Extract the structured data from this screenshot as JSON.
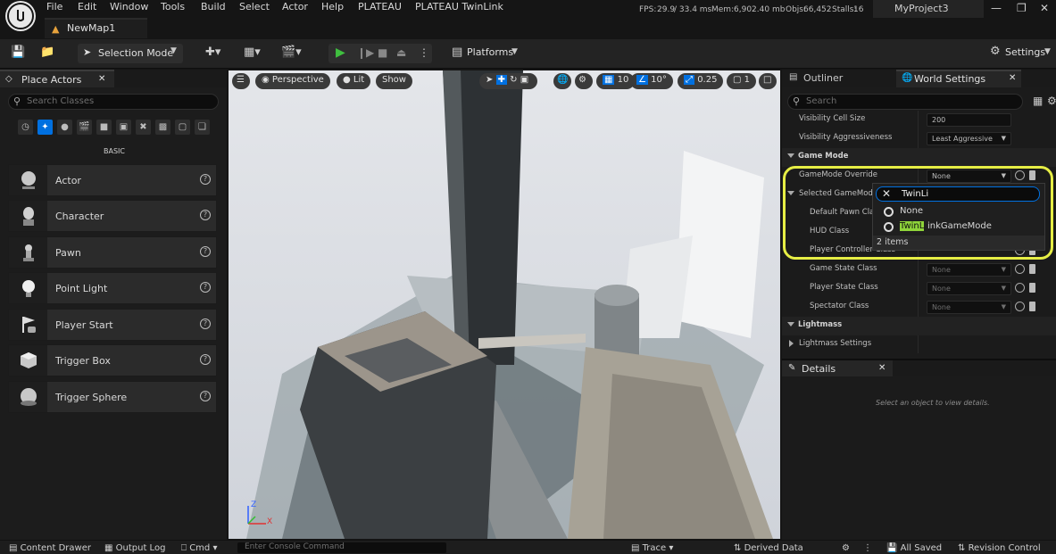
{
  "app": {
    "menu": [
      "File",
      "Edit",
      "Window",
      "Tools",
      "Build",
      "Select",
      "Actor",
      "Help",
      "PLATEAU",
      "PLATEAU TwinLink"
    ],
    "stats": {
      "fps_label": "FPS:",
      "fps": "29.9",
      "ms": "/ 33.4 ms",
      "mem_label": "Mem:",
      "mem": "6,902.40 mb",
      "objs_label": "Objs:",
      "objs": "66,452",
      "stalls_label": "Stalls:",
      "stalls": "16"
    },
    "project_tab": "MyProject3",
    "map_tab": "NewMap1"
  },
  "toolbar": {
    "selection_mode": "Selection Mode",
    "platforms": "Platforms",
    "settings": "Settings"
  },
  "place_actors": {
    "tab_title": "Place Actors",
    "search_placeholder": "Search Classes",
    "category_label": "BASIC",
    "items": [
      {
        "label": "Actor"
      },
      {
        "label": "Character"
      },
      {
        "label": "Pawn"
      },
      {
        "label": "Point Light"
      },
      {
        "label": "Player Start"
      },
      {
        "label": "Trigger Box"
      },
      {
        "label": "Trigger Sphere"
      }
    ]
  },
  "viewport": {
    "perspective": "Perspective",
    "lit": "Lit",
    "show": "Show",
    "grid_snap": "10",
    "rot_snap": "10°",
    "scale_snap": "0.25",
    "camera_speed": "1",
    "axis_x": "X",
    "axis_z": "Z"
  },
  "right_panel": {
    "tab_outliner": "Outliner",
    "tab_world_settings": "World Settings",
    "search_placeholder": "Search",
    "visibility_cell_size_label": "Visibility Cell Size",
    "visibility_cell_size_value": "200",
    "visibility_aggressiveness_label": "Visibility Aggressiveness",
    "visibility_aggressiveness_value": "Least Aggressive",
    "section_game_mode": "Game Mode",
    "gamemode_override_label": "GameMode Override",
    "gamemode_override_value": "None",
    "selected_gamemode_label": "Selected GameMode",
    "default_pawn_label": "Default Pawn Class",
    "hud_class_label": "HUD Class",
    "player_controller_label": "Player Controller Class",
    "game_state_label": "Game State Class",
    "game_state_value": "None",
    "player_state_label": "Player State Class",
    "player_state_value": "None",
    "spectator_label": "Spectator Class",
    "spectator_value": "None",
    "section_lightmass": "Lightmass",
    "lightmass_settings_label": "Lightmass Settings",
    "details_tab": "Details",
    "details_empty": "Select an object to view details."
  },
  "dropdown": {
    "search_value": "TwinLi",
    "options": [
      {
        "label": "None"
      },
      {
        "match": "TwinL",
        "rest": "inkGameMode"
      }
    ],
    "count": "2 items"
  },
  "bottom": {
    "content_drawer": "Content Drawer",
    "output_log": "Output Log",
    "cmd": "Cmd",
    "console_placeholder": "Enter Console Command",
    "trace": "Trace",
    "derived_data": "Derived Data",
    "all_saved": "All Saved",
    "revision_control": "Revision Control"
  },
  "colors": {
    "accent_blue": "#0070e0",
    "highlight_yellow": "#e6ee45",
    "play_green": "#3fbf3f"
  }
}
